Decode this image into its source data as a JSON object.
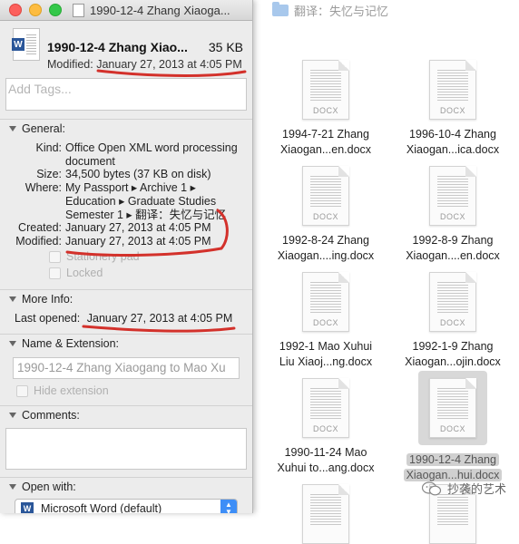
{
  "finder": {
    "path_label": "翻译：失忆与记忆",
    "files": [
      {
        "ext": "DOCX",
        "name_line1": "1994-7-21 Zhang",
        "name_line2": "Xiaogan...en.docx"
      },
      {
        "ext": "DOCX",
        "name_line1": "1996-10-4 Zhang",
        "name_line2": "Xiaogan...ica.docx"
      },
      {
        "ext": "DOCX",
        "name_line1": "1992-8-24 Zhang",
        "name_line2": "Xiaogan....ing.docx"
      },
      {
        "ext": "DOCX",
        "name_line1": "1992-8-9 Zhang",
        "name_line2": "Xiaogan....en.docx"
      },
      {
        "ext": "DOCX",
        "name_line1": "1992-1 Mao Xuhui",
        "name_line2": "Liu Xiaoj...ng.docx"
      },
      {
        "ext": "DOCX",
        "name_line1": "1992-1-9 Zhang",
        "name_line2": "Xiaogan...ojin.docx"
      },
      {
        "ext": "DOCX",
        "name_line1": "1990-11-24 Mao",
        "name_line2": "Xuhui to...ang.docx"
      },
      {
        "ext": "DOCX",
        "name_line1": "1990-12-4 Zhang",
        "name_line2": "Xiaogan...hui.docx"
      },
      {
        "ext": "",
        "name_line1": "",
        "name_line2": ""
      },
      {
        "ext": "",
        "name_line1": "",
        "name_line2": ""
      }
    ],
    "watermark": "抄袭的艺术"
  },
  "info": {
    "window_title": "1990-12-4 Zhang Xiaoga...",
    "file_name": "1990-12-4 Zhang Xiao...",
    "file_size": "35 KB",
    "modified_label": "Modified:",
    "modified_value": "January 27, 2013 at 4:05 PM",
    "tags_placeholder": "Add Tags...",
    "general": {
      "header": "General:",
      "kind_label": "Kind:",
      "kind_line1": "Office Open XML word processing",
      "kind_line2": "document",
      "size_label": "Size:",
      "size_value": "34,500 bytes (37 KB on disk)",
      "where_label": "Where:",
      "where_line1": "My Passport ▸ Archive 1 ▸",
      "where_line2": "Education ▸ Graduate Studies",
      "where_line3": "Semester 1 ▸ 翻译：失忆与记忆",
      "created_label": "Created:",
      "created_value": "January 27, 2013 at 4:05 PM",
      "modified_label": "Modified:",
      "modified_value": "January 27, 2013 at 4:05 PM",
      "stationery_label": "Stationery pad",
      "locked_label": "Locked"
    },
    "more_info": {
      "header": "More Info:",
      "last_opened_label": "Last opened:",
      "last_opened_value": "January 27, 2013 at 4:05 PM"
    },
    "name_ext": {
      "header": "Name & Extension:",
      "name_value": "1990-12-4 Zhang Xiaogang to Mao Xu",
      "hide_ext_label": "Hide extension"
    },
    "comments": {
      "header": "Comments:"
    },
    "open_with": {
      "header": "Open with:",
      "app_label": "Microsoft Word (default)",
      "app_icon": "W"
    }
  },
  "colors": {
    "annotation": "#d3312b",
    "word_blue": "#2a5699",
    "select_blue": "#3d8ef7"
  }
}
